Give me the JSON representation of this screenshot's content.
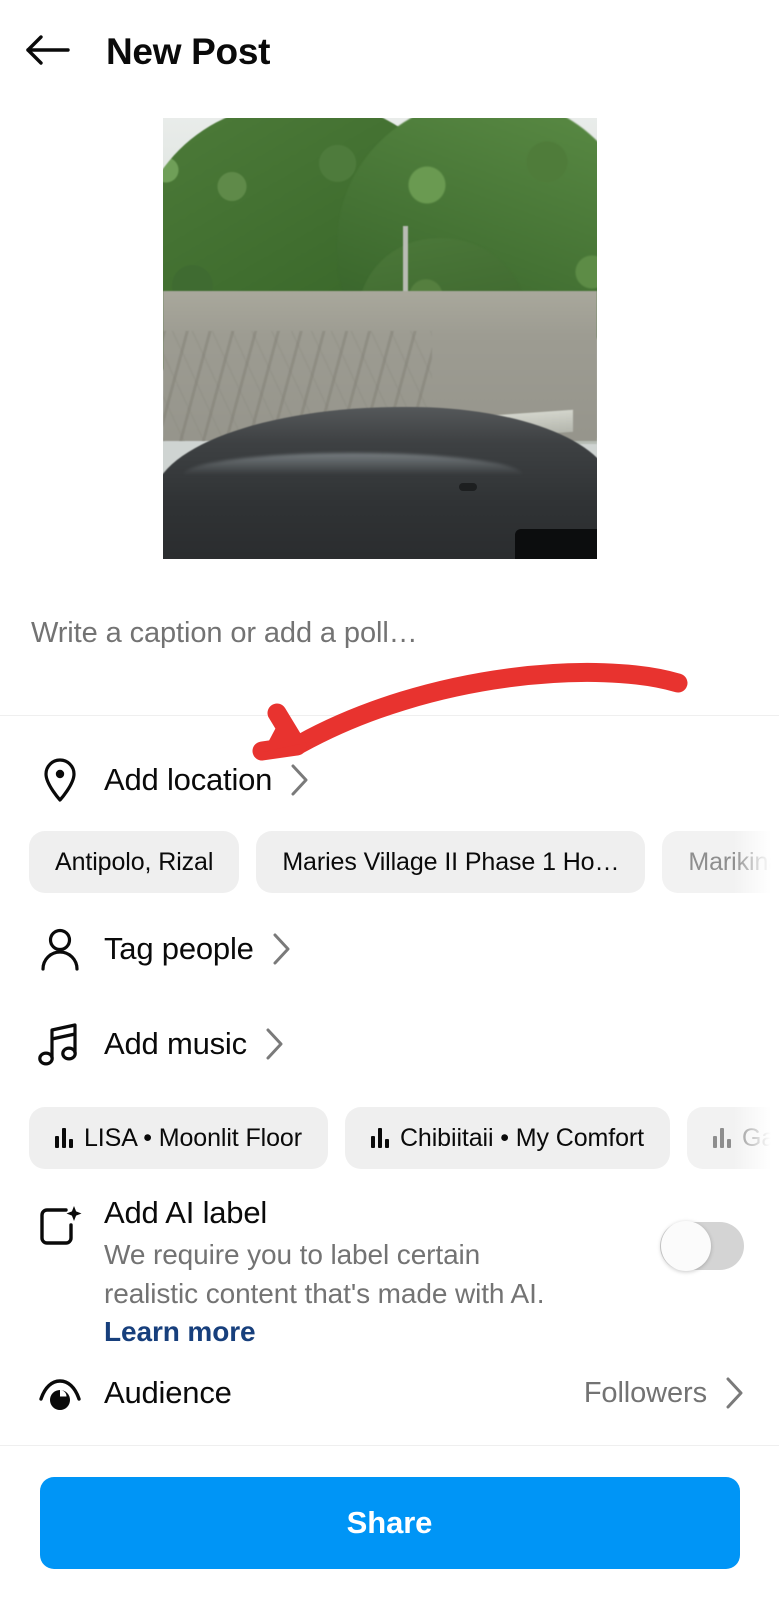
{
  "header": {
    "back_icon": "back-arrow-icon",
    "title": "New Post"
  },
  "media": {
    "alt": "dashcam photo of tree lined street with mosaic tile wall"
  },
  "caption": {
    "placeholder": "Write a caption or add a poll…",
    "value": ""
  },
  "location": {
    "icon": "location-pin-icon",
    "label": "Add location",
    "chevron": "chevron-right-icon",
    "suggestions": [
      {
        "label": "Antipolo, Rizal",
        "faded": false
      },
      {
        "label": "Maries Village II Phase 1 Ho…",
        "faded": false
      },
      {
        "label": "Marikina",
        "faded": true
      }
    ]
  },
  "tag_people": {
    "icon": "person-icon",
    "label": "Tag people",
    "chevron": "chevron-right-icon"
  },
  "music": {
    "icon": "music-note-icon",
    "label": "Add music",
    "chevron": "chevron-right-icon",
    "suggestions": [
      {
        "label": "LISA • Moonlit Floor",
        "faded": false
      },
      {
        "label": "Chibiitaii • My Comfort",
        "faded": false
      },
      {
        "label": "Gat F",
        "faded": true
      }
    ]
  },
  "ai_label": {
    "icon": "ai-sparkle-icon",
    "title": "Add AI label",
    "description_line1": "We require you to label certain realistic",
    "description_line2": "content that's made with AI. ",
    "learn_more": "Learn more",
    "toggle_state": "off"
  },
  "audience": {
    "icon": "audience-privacy-icon",
    "label": "Audience",
    "value": "Followers",
    "chevron": "chevron-right-icon"
  },
  "share": {
    "label": "Share"
  },
  "annotation": {
    "type": "curved-arrow",
    "color": "#E8332F",
    "points_to": "Add location"
  },
  "colors": {
    "accent_blue": "#0095F6",
    "link_blue": "#173F7C",
    "chip_bg": "#EFEFEF",
    "text_primary": "#0A0A0A",
    "text_secondary": "#737373",
    "annotation_red": "#E8332F"
  }
}
